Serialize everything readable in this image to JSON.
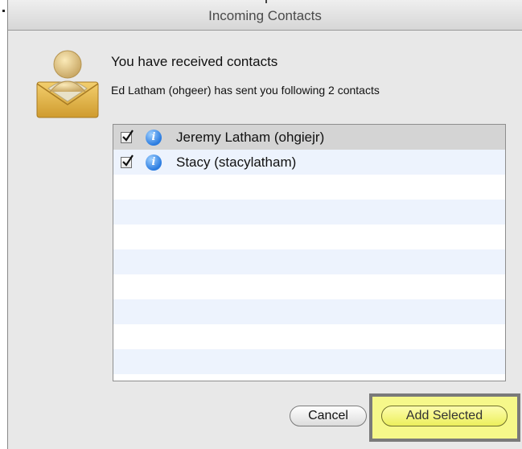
{
  "window": {
    "title": "Incoming Contacts"
  },
  "dialog": {
    "heading": "You have received contacts",
    "message": "Ed Latham (ohgeer) has sent you following 2 contacts"
  },
  "contacts": [
    {
      "label": "Jeremy Latham (ohgiejr)",
      "checked": true,
      "selected": true
    },
    {
      "label": "Stacy (stacylatham)",
      "checked": true,
      "selected": false
    }
  ],
  "buttons": {
    "cancel": "Cancel",
    "add_selected": "Add Selected"
  },
  "colors": {
    "highlight": "#f6f88a",
    "stripe": "#edf3fd",
    "info": "#2a7be0"
  }
}
